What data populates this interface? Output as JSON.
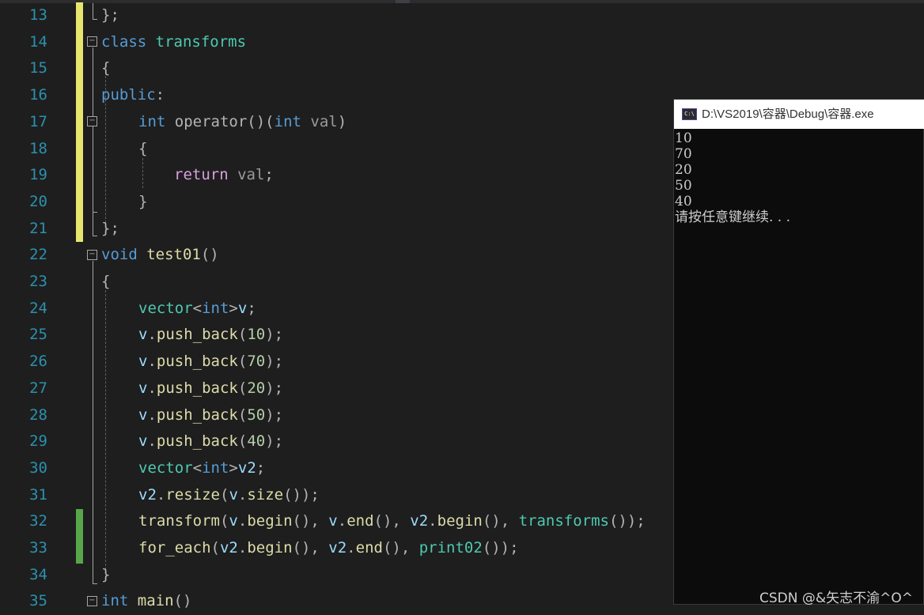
{
  "line_numbers": [
    "13",
    "14",
    "15",
    "16",
    "17",
    "18",
    "19",
    "20",
    "21",
    "22",
    "23",
    "24",
    "25",
    "26",
    "27",
    "28",
    "29",
    "30",
    "31",
    "32",
    "33",
    "34",
    "35"
  ],
  "code": {
    "l13": {
      "brace": "};"
    },
    "l14": {
      "kw": "class",
      "name": "transforms"
    },
    "l15": {
      "brace": "{"
    },
    "l16": {
      "kw": "public",
      "colon": ":"
    },
    "l17": {
      "t1": "int",
      "fn": "operator",
      "p1": "()(",
      "t2": "int",
      "param": "val",
      "p2": ")"
    },
    "l18": {
      "brace": "{"
    },
    "l19": {
      "kw": "return",
      "param": "val",
      "semi": ";"
    },
    "l20": {
      "brace": "}"
    },
    "l21": {
      "brace": "};"
    },
    "l22": {
      "kw": "void",
      "fn": "test01",
      "paren": "()"
    },
    "l23": {
      "brace": "{"
    },
    "l24": {
      "ty": "vector",
      "lt": "<",
      "kw": "int",
      "gt": ">",
      "var": "v",
      "semi": ";"
    },
    "l25": {
      "var": "v",
      "dot": ".",
      "fn": "push_back",
      "op": "(",
      "num": "10",
      "cp": ");"
    },
    "l26": {
      "var": "v",
      "dot": ".",
      "fn": "push_back",
      "op": "(",
      "num": "70",
      "cp": ");"
    },
    "l27": {
      "var": "v",
      "dot": ".",
      "fn": "push_back",
      "op": "(",
      "num": "20",
      "cp": ");"
    },
    "l28": {
      "var": "v",
      "dot": ".",
      "fn": "push_back",
      "op": "(",
      "num": "50",
      "cp": ");"
    },
    "l29": {
      "var": "v",
      "dot": ".",
      "fn": "push_back",
      "op": "(",
      "num": "40",
      "cp": ");"
    },
    "l30": {
      "ty": "vector",
      "lt": "<",
      "kw": "int",
      "gt": ">",
      "var": "v2",
      "semi": ";"
    },
    "l31": {
      "var": "v2",
      "dot": ".",
      "fn": "resize",
      "op": "(",
      "var2": "v",
      "dot2": ".",
      "fn2": "size",
      "cp": "());"
    },
    "l32": {
      "fn": "transform",
      "op": "(",
      "v1": "v",
      "d1": ".",
      "f1": "begin",
      "c1": "(), ",
      "v2": "v",
      "d2": ".",
      "f2": "end",
      "c2": "(), ",
      "v3": "v2",
      "d3": ".",
      "f3": "begin",
      "c3": "(), ",
      "ty": "transforms",
      "cp": "());"
    },
    "l33": {
      "fn": "for_each",
      "op": "(",
      "v1": "v2",
      "d1": ".",
      "f1": "begin",
      "c1": "(), ",
      "v2": "v2",
      "d2": ".",
      "f2": "end",
      "c2": "(), ",
      "ty": "print02",
      "cp": "());"
    },
    "l34": {
      "brace": "}"
    },
    "l35": {
      "kw": "int",
      "fn": "main",
      "paren": "()"
    }
  },
  "console": {
    "title": "D:\\VS2019\\容器\\Debug\\容器.exe",
    "icon_label": "C:\\",
    "output": [
      "10",
      "70",
      "20",
      "50",
      "40",
      "请按任意键继续. . ."
    ]
  },
  "watermark": "CSDN @&矢志不渝^O^",
  "colors": {
    "background": "#1e1e1e",
    "line_number": "#2b91af",
    "keyword": "#569cd6",
    "type": "#4ec9b0",
    "function": "#dcdcaa",
    "variable": "#9cdcfe",
    "number": "#b5cea8",
    "control_keyword": "#d8a0df",
    "change_unsaved": "#e6e66e",
    "change_saved": "#57a64a"
  }
}
